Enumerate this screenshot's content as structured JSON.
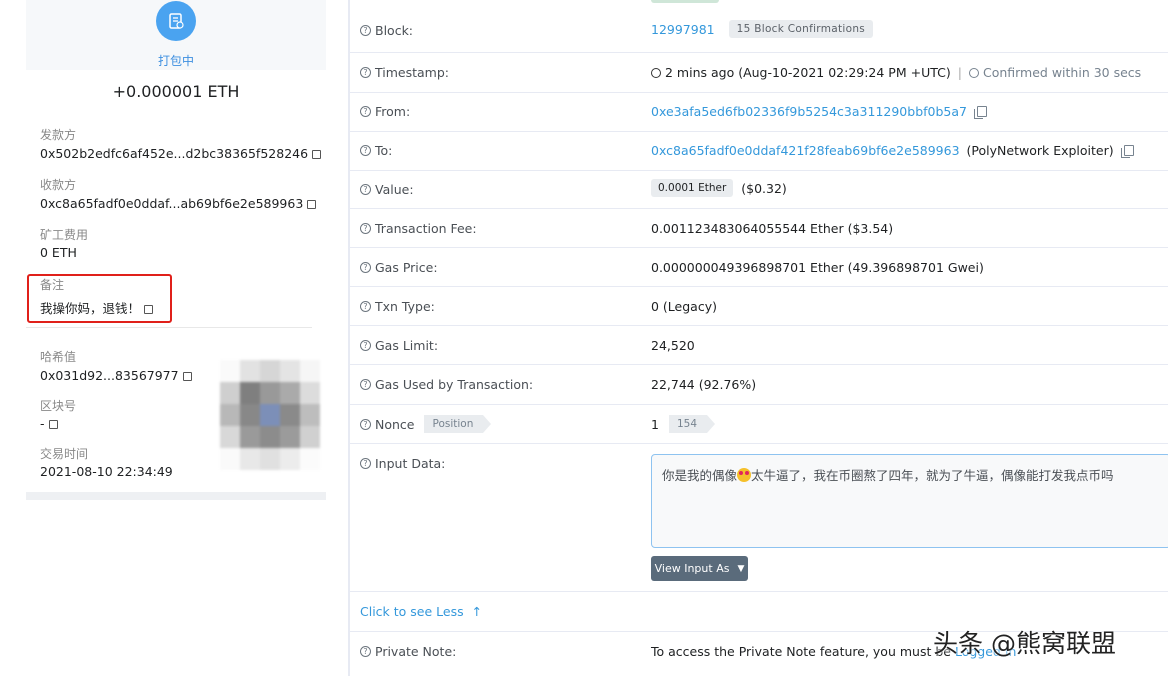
{
  "wallet": {
    "status_label": "打包中",
    "amount": "+0.000001 ETH",
    "sender_label": "发款方",
    "sender_value": "0x502b2edfc6af452e...d2bc38365f528246",
    "receiver_label": "收款方",
    "receiver_value": "0xc8a65fadf0e0ddaf...ab69bf6e2e589963",
    "fee_label": "矿工费用",
    "fee_value": "0 ETH",
    "memo_label": "备注",
    "memo_value": "我操你妈，退钱！",
    "hash_label": "哈希值",
    "hash_value": "0x031d92...83567977",
    "block_label": "区块号",
    "block_value": "-",
    "time_label": "交易时间",
    "time_value": "2021-08-10 22:34:49"
  },
  "tx": {
    "block": {
      "label": "Block:",
      "value": "12997981",
      "badge": "15 Block Confirmations"
    },
    "timestamp": {
      "label": "Timestamp:",
      "value": "2 mins ago (Aug-10-2021 02:29:24 PM +UTC)",
      "sep": "|",
      "confirmed": "Confirmed within 30 secs"
    },
    "from": {
      "label": "From:",
      "value": "0xe3afa5ed6fb02336f9b5254c3a311290bbf0b5a7"
    },
    "to": {
      "label": "To:",
      "value": "0xc8a65fadf0e0ddaf421f28feab69bf6e2e589963",
      "tag": "(PolyNetwork Exploiter)"
    },
    "value": {
      "label": "Value:",
      "pill": "0.0001 Ether",
      "usd": "($0.32)"
    },
    "fee": {
      "label": "Transaction Fee:",
      "value": "0.001123483064055544 Ether ($3.54)"
    },
    "gas_price": {
      "label": "Gas Price:",
      "value": "0.000000049396898701 Ether (49.396898701 Gwei)"
    },
    "txn_type": {
      "label": "Txn Type:",
      "value": "0 (Legacy)"
    },
    "gas_limit": {
      "label": "Gas Limit:",
      "value": "24,520"
    },
    "gas_used": {
      "label": "Gas Used by Transaction:",
      "value": "22,744 (92.76%)"
    },
    "nonce": {
      "label": "Nonce",
      "badge": "Position",
      "value": "1",
      "position": "154"
    },
    "input": {
      "label": "Input Data:",
      "text_before": "你是我的偶像",
      "text_after": "太牛逼了，我在币圈熬了四年，就为了牛逼，偶像能打发我点币吗",
      "button": "View Input As"
    },
    "see_less": "Click to see Less",
    "private_note": {
      "label": "Private Note:",
      "value": "To access the Private Note feature, you must be",
      "link": "Logged In"
    }
  },
  "watermark": "头条 @熊窝联盟",
  "colors": {
    "link": "#3498db",
    "accent": "#4aa3f0",
    "highlight": "#e0201a"
  }
}
